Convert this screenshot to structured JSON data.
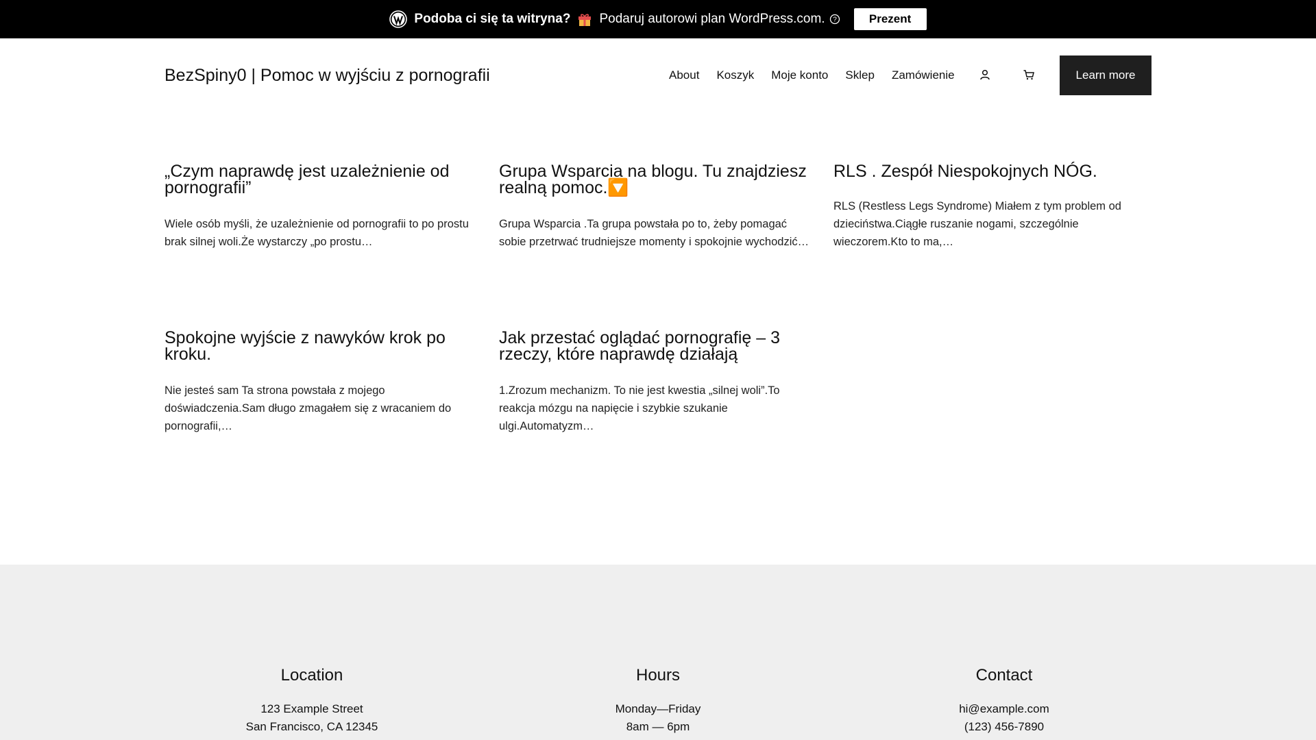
{
  "promo": {
    "question": "Podoba ci się ta witryna?",
    "offer": "Podaruj autorowi plan WordPress.com.",
    "button": "Prezent"
  },
  "header": {
    "site_title": "BezSpiny0 | Pomoc w wyjściu z pornografii",
    "nav": [
      "About",
      "Koszyk",
      "Moje konto",
      "Sklep",
      "Zamówienie"
    ],
    "cta": "Learn more"
  },
  "posts": [
    {
      "title": "„Czym naprawdę jest uzależnienie od pornografii”",
      "excerpt": "Wiele osób myśli, że uzależnienie od pornografii to po prostu brak silnej woli.Że wystarczy „po prostu…"
    },
    {
      "title": "Grupa Wsparcia na blogu. Tu znajdziesz realną pomoc.🔽",
      "excerpt": "Grupa Wsparcia .Ta grupa powstała po to, żeby pomagać sobie przetrwać trudniejsze momenty i spokojnie wychodzić…"
    },
    {
      "title": "RLS . Zespół Niespokojnych NÓG.",
      "excerpt": "RLS (Restless Legs Syndrome) Miałem z tym problem od dzieciństwa.Ciągłe ruszanie nogami, szczególnie wieczorem.Kto to ma,…"
    },
    {
      "title": "Spokojne wyjście z nawyków krok po kroku.",
      "excerpt": "Nie jesteś sam Ta strona powstała z mojego doświadczenia.Sam długo zmagałem się z wracaniem do pornografii,…"
    },
    {
      "title": "Jak przestać oglądać pornografię – 3 rzeczy, które naprawdę działają",
      "excerpt": "1.Zrozum mechanizm.  To nie jest kwestia „silnej woli”.To reakcja mózgu na napięcie i szybkie szukanie ulgi.Automatyzm…"
    }
  ],
  "footer": {
    "location": {
      "heading": "Location",
      "line1": "123 Example Street",
      "line2": "San Francisco, CA 12345"
    },
    "hours": {
      "heading": "Hours",
      "line1": "Monday—Friday",
      "line2": "8am — 6pm"
    },
    "contact": {
      "heading": "Contact",
      "line1": "hi@example.com",
      "line2": "(123) 456-7890"
    }
  },
  "icons": {
    "wordpress": "wordpress-logo-icon",
    "gift": "gift-icon",
    "help": "help-circle-icon",
    "user": "user-icon",
    "cart": "cart-icon"
  }
}
